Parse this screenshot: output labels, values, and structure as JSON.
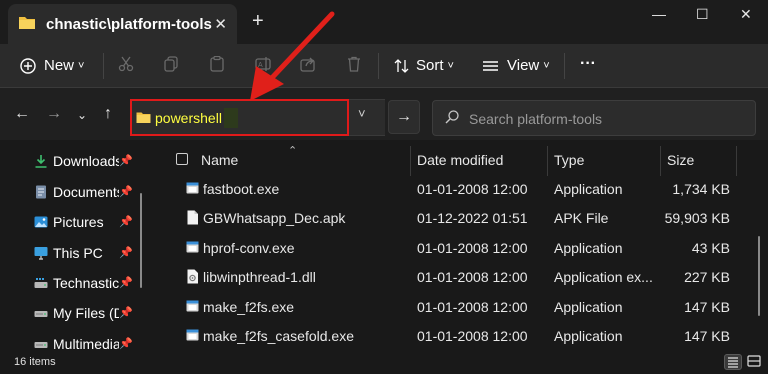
{
  "window": {
    "tab_title": "chnastic\\platform-tools",
    "new_tab_label": "+",
    "close_tab_label": "✕",
    "minimize_label": "—",
    "maximize_label": "☐",
    "close_window_label": "✕"
  },
  "toolbar": {
    "new_label": "New",
    "sort_label": "Sort",
    "view_label": "View",
    "more_label": "···",
    "chevron": "˅"
  },
  "address": {
    "path_value": "powershell",
    "search_placeholder": "Search platform-tools"
  },
  "sidebar": {
    "items": [
      {
        "label": "Downloads",
        "icon": "download-icon",
        "pinned": true
      },
      {
        "label": "Documents",
        "icon": "documents-icon",
        "pinned": true
      },
      {
        "label": "Pictures",
        "icon": "pictures-icon",
        "pinned": true
      },
      {
        "label": "This PC",
        "icon": "computer-icon",
        "pinned": true
      },
      {
        "label": "Technastic",
        "icon": "drive-icon",
        "pinned": true
      },
      {
        "label": "My Files (D:)",
        "icon": "drive-icon",
        "pinned": true
      },
      {
        "label": "Multimedia",
        "icon": "drive-icon",
        "pinned": true
      }
    ]
  },
  "list": {
    "columns": {
      "name": "Name",
      "date": "Date modified",
      "type": "Type",
      "size": "Size"
    },
    "rows": [
      {
        "name": "fastboot.exe",
        "date": "01-01-2008 12:00",
        "type": "Application",
        "size": "1,734 KB",
        "icon": "exe-icon"
      },
      {
        "name": "GBWhatsapp_Dec.apk",
        "date": "01-12-2022 01:51",
        "type": "APK File",
        "size": "59,903 KB",
        "icon": "file-icon"
      },
      {
        "name": "hprof-conv.exe",
        "date": "01-01-2008 12:00",
        "type": "Application",
        "size": "43 KB",
        "icon": "exe-icon"
      },
      {
        "name": "libwinpthread-1.dll",
        "date": "01-01-2008 12:00",
        "type": "Application ex...",
        "size": "227 KB",
        "icon": "dll-icon"
      },
      {
        "name": "make_f2fs.exe",
        "date": "01-01-2008 12:00",
        "type": "Application",
        "size": "147 KB",
        "icon": "exe-icon"
      },
      {
        "name": "make_f2fs_casefold.exe",
        "date": "01-01-2008 12:00",
        "type": "Application",
        "size": "147 KB",
        "icon": "exe-icon"
      }
    ]
  },
  "status": {
    "item_count": "16 items"
  },
  "colors": {
    "accent_folder": "#f0c040",
    "highlight_border": "#e01a1a",
    "arrow": "#e0201a",
    "path_text": "#ffff40"
  }
}
